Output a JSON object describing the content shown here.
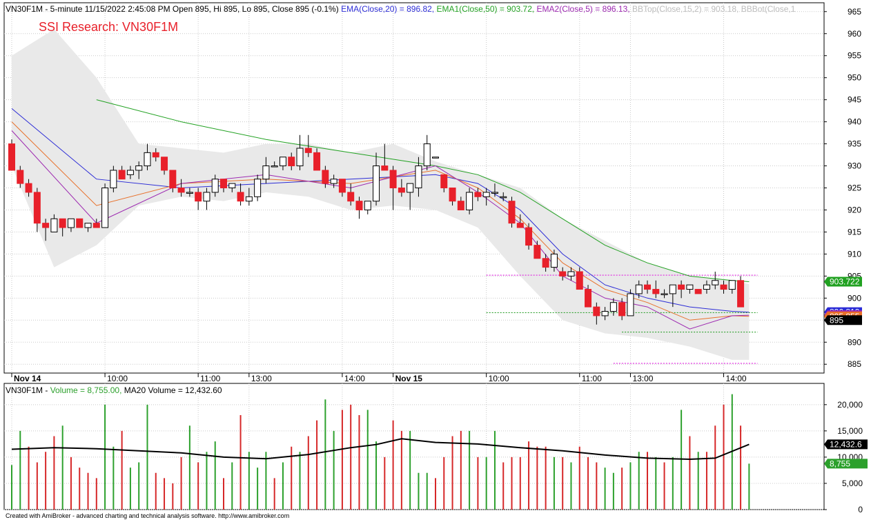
{
  "header": {
    "prefix": "VN30F1M - 5-minute 11/15/2022 2:45:08 PM Open 895, Hi 895, Lo 895, Close 895 (-0.1%) ",
    "ema20": "EMA(Close,20) = 896.82, ",
    "ema50": "EMA1(Close,50) = 903.72, ",
    "ema5": "EMA2(Close,5) = 896.13, ",
    "bbtop": "BBTop(Close,15,2) = 903.18, ",
    "bbbot": "BBBot(Close,1"
  },
  "watermark": "SSI Research: VN30F1M",
  "volume_header": {
    "prefix": "VN30F1M - ",
    "volume": "Volume = 8,755.00, ",
    "ma20": "MA20 Volume = 12,432.60"
  },
  "footer": "Created with AmiBroker - advanced charting and technical analysis software. http://www.amibroker.com",
  "value_tags": [
    {
      "label": "903.722",
      "value": 903.72,
      "bg": "#21a121",
      "fg": "#ffffff"
    },
    {
      "label": "896.819",
      "value": 896.82,
      "bg": "#2b2bd6",
      "fg": "#ffffff"
    },
    {
      "label": "896.128",
      "value": 896.13,
      "bg": "#9c27b0",
      "fg": "#ffffff"
    },
    {
      "label": "895.855",
      "value": 895.86,
      "bg": "#e8702a",
      "fg": "#ffffff"
    },
    {
      "label": "895",
      "value": 895,
      "bg": "#000000",
      "fg": "#ffffff"
    }
  ],
  "volume_tags": [
    {
      "label": "12,432.6",
      "value": 12432.6,
      "bg": "#000000",
      "fg": "#ffffff"
    },
    {
      "label": "8,755",
      "value": 8755,
      "bg": "#2ca02c",
      "fg": "#ffffff"
    }
  ],
  "colors": {
    "up_fill": "#ffffff",
    "down_fill": "#e8202a",
    "candle_outline": "#000000",
    "ema20": "#2b2bd6",
    "ema50": "#21a121",
    "ema5": "#9c27b0",
    "ema_orange": "#e8702a",
    "bb_band": "#e9e9e9",
    "vol_up": "#2ca02c",
    "vol_down": "#d62728",
    "vol_ma": "#000000",
    "level_magenta": "#e020e0",
    "level_green": "#2ca02c",
    "grid": "#c8c8c8"
  },
  "chart_data": [
    {
      "type": "candlestick",
      "title": "VN30F1M - 5-minute",
      "ylim": [
        883,
        967
      ],
      "y_ticks": [
        885,
        890,
        895,
        900,
        905,
        910,
        915,
        920,
        925,
        930,
        935,
        940,
        945,
        950,
        955,
        960,
        965
      ],
      "x_ticks": [
        {
          "i": 0,
          "label": "Nov 14",
          "bold": true
        },
        {
          "i": 11,
          "label": "10:00"
        },
        {
          "i": 22,
          "label": "11:00"
        },
        {
          "i": 28,
          "label": "13:00"
        },
        {
          "i": 39,
          "label": "14:00"
        },
        {
          "i": 45,
          "label": "Nov 15",
          "bold": true
        },
        {
          "i": 56,
          "label": "10:00"
        },
        {
          "i": 67,
          "label": "11:00"
        },
        {
          "i": 73,
          "label": "13:00"
        },
        {
          "i": 84,
          "label": "14:00"
        }
      ],
      "grid": true,
      "candles": [
        [
          935,
          936,
          929,
          929
        ],
        [
          929,
          930,
          925,
          926
        ],
        [
          926,
          927,
          923,
          924
        ],
        [
          924,
          925,
          915,
          917
        ],
        [
          917,
          918,
          913,
          916
        ],
        [
          915,
          919,
          915,
          918
        ],
        [
          918,
          918,
          914,
          916
        ],
        [
          916,
          918,
          915,
          918
        ],
        [
          918,
          918,
          916,
          916
        ],
        [
          916,
          917,
          915,
          917
        ],
        [
          917,
          918,
          916,
          916
        ],
        [
          916,
          926,
          916,
          925
        ],
        [
          925,
          930,
          924,
          929
        ],
        [
          929,
          930,
          927,
          927
        ],
        [
          928,
          930,
          927,
          929
        ],
        [
          929,
          931,
          927,
          930
        ],
        [
          930,
          935,
          929,
          933
        ],
        [
          933,
          934,
          931,
          932
        ],
        [
          932,
          932,
          928,
          929
        ],
        [
          929,
          929,
          924,
          925
        ],
        [
          925,
          927,
          923,
          924
        ],
        [
          924,
          925,
          923,
          924
        ],
        [
          924,
          925,
          920,
          922
        ],
        [
          922,
          925,
          920,
          924
        ],
        [
          924,
          928,
          923,
          927
        ],
        [
          927,
          927,
          924,
          925
        ],
        [
          925,
          926,
          924,
          926
        ],
        [
          924,
          926,
          921,
          922
        ],
        [
          922,
          925,
          921,
          923
        ],
        [
          923,
          928,
          922,
          927
        ],
        [
          927,
          932,
          926,
          930
        ],
        [
          930,
          931,
          930,
          930
        ],
        [
          930,
          932,
          929,
          932
        ],
        [
          932,
          933,
          929,
          930
        ],
        [
          930,
          937,
          929,
          934
        ],
        [
          934,
          937,
          932,
          933
        ],
        [
          933,
          934,
          929,
          929
        ],
        [
          929,
          930,
          925,
          926
        ],
        [
          926,
          928,
          925,
          927
        ],
        [
          927,
          927,
          923,
          924
        ],
        [
          924,
          926,
          921,
          922
        ],
        [
          922,
          923,
          918,
          920
        ],
        [
          920,
          922,
          919,
          922
        ],
        [
          922,
          933,
          921,
          930
        ],
        [
          930,
          935,
          929,
          929
        ],
        [
          929,
          930,
          920,
          925
        ],
        [
          925,
          927,
          923,
          924
        ],
        [
          924,
          925,
          920,
          926
        ],
        [
          925,
          932,
          923,
          930
        ],
        [
          930,
          937,
          929,
          935
        ],
        [
          932,
          932,
          932,
          932
        ],
        [
          928,
          928,
          924,
          925
        ],
        [
          925,
          925,
          921,
          922
        ],
        [
          922,
          923,
          920,
          920
        ],
        [
          920,
          925,
          919,
          924
        ],
        [
          924,
          925,
          922,
          923
        ],
        [
          923,
          925,
          921,
          924
        ],
        [
          924,
          926,
          923,
          924
        ],
        [
          923,
          924,
          922,
          923
        ],
        [
          922,
          923,
          916,
          917
        ],
        [
          917,
          919,
          916,
          916
        ],
        [
          916,
          917,
          911,
          912
        ],
        [
          912,
          913,
          909,
          909
        ],
        [
          909,
          910,
          906,
          907
        ],
        [
          907,
          911,
          906,
          910
        ],
        [
          906,
          907,
          904,
          905
        ],
        [
          905,
          907,
          904,
          906
        ],
        [
          906,
          907,
          902,
          902
        ],
        [
          902,
          903,
          898,
          898
        ],
        [
          898,
          899,
          894,
          896
        ],
        [
          896,
          898,
          895,
          897
        ],
        [
          897,
          900,
          896,
          899
        ],
        [
          899,
          900,
          895,
          896
        ],
        [
          896,
          902,
          896,
          901
        ],
        [
          901,
          904,
          900,
          903
        ],
        [
          903,
          904,
          901,
          902
        ],
        [
          902,
          904,
          900,
          901
        ],
        [
          901,
          902,
          900,
          901
        ],
        [
          901,
          903,
          898,
          903
        ],
        [
          903,
          904,
          900,
          902
        ],
        [
          902,
          903,
          901,
          903
        ],
        [
          902,
          902,
          901,
          901
        ],
        [
          902,
          904,
          901,
          903
        ],
        [
          903,
          906,
          902,
          904
        ],
        [
          903,
          904,
          901,
          902
        ],
        [
          902,
          904,
          901,
          904
        ],
        [
          904,
          905,
          898,
          898
        ]
      ],
      "ema20": [
        [
          0,
          943
        ],
        [
          10,
          927
        ],
        [
          20,
          925
        ],
        [
          30,
          926
        ],
        [
          40,
          927
        ],
        [
          50,
          928
        ],
        [
          55,
          926
        ],
        [
          60,
          920
        ],
        [
          65,
          910
        ],
        [
          70,
          903
        ],
        [
          75,
          900
        ],
        [
          80,
          898
        ],
        [
          85,
          897
        ],
        [
          87,
          896.82
        ]
      ],
      "ema50": [
        [
          10,
          945
        ],
        [
          20,
          940
        ],
        [
          30,
          936
        ],
        [
          40,
          933
        ],
        [
          50,
          930
        ],
        [
          55,
          928
        ],
        [
          60,
          924
        ],
        [
          65,
          918
        ],
        [
          70,
          912
        ],
        [
          75,
          908
        ],
        [
          80,
          905
        ],
        [
          85,
          904
        ],
        [
          87,
          903.72
        ]
      ],
      "ema5": [
        [
          0,
          938
        ],
        [
          10,
          917
        ],
        [
          20,
          926
        ],
        [
          30,
          928
        ],
        [
          40,
          925
        ],
        [
          50,
          930
        ],
        [
          55,
          924
        ],
        [
          60,
          917
        ],
        [
          65,
          905
        ],
        [
          70,
          900
        ],
        [
          75,
          898
        ],
        [
          80,
          893
        ],
        [
          85,
          896
        ],
        [
          87,
          896.13
        ]
      ],
      "ema_orange": [
        [
          0,
          940
        ],
        [
          10,
          921
        ],
        [
          20,
          926
        ],
        [
          30,
          927
        ],
        [
          40,
          926
        ],
        [
          50,
          929
        ],
        [
          55,
          925
        ],
        [
          60,
          918
        ],
        [
          65,
          908
        ],
        [
          70,
          902
        ],
        [
          75,
          899
        ],
        [
          80,
          895
        ],
        [
          85,
          896
        ],
        [
          87,
          895.86
        ]
      ],
      "bb_upper": [
        [
          0,
          955
        ],
        [
          5,
          961
        ],
        [
          10,
          950
        ],
        [
          15,
          935
        ],
        [
          20,
          934
        ],
        [
          25,
          933
        ],
        [
          30,
          935
        ],
        [
          35,
          935
        ],
        [
          40,
          933
        ],
        [
          45,
          935
        ],
        [
          50,
          931
        ],
        [
          55,
          928
        ],
        [
          60,
          925
        ],
        [
          65,
          918
        ],
        [
          70,
          913
        ],
        [
          75,
          908
        ],
        [
          80,
          905
        ],
        [
          85,
          904
        ],
        [
          87,
          903.18
        ]
      ],
      "bb_lower": [
        [
          0,
          930
        ],
        [
          5,
          907
        ],
        [
          10,
          912
        ],
        [
          15,
          921
        ],
        [
          20,
          923
        ],
        [
          25,
          922
        ],
        [
          30,
          924
        ],
        [
          35,
          923
        ],
        [
          40,
          920
        ],
        [
          45,
          921
        ],
        [
          50,
          920
        ],
        [
          55,
          916
        ],
        [
          60,
          905
        ],
        [
          65,
          895
        ],
        [
          70,
          892
        ],
        [
          75,
          891
        ],
        [
          80,
          889
        ],
        [
          85,
          886
        ],
        [
          87,
          886
        ]
      ],
      "levels": [
        {
          "from": 56,
          "to": 88,
          "value": 905.2,
          "color": "#e020e0"
        },
        {
          "from": 56,
          "to": 88,
          "value": 896.7,
          "color": "#2ca02c"
        },
        {
          "from": 72,
          "to": 88,
          "value": 892.3,
          "color": "#2ca02c"
        },
        {
          "from": 71,
          "to": 88,
          "value": 885.2,
          "color": "#e020e0"
        }
      ]
    },
    {
      "type": "bar",
      "title": "Volume",
      "ylim": [
        0,
        23000
      ],
      "y_ticks": [
        0,
        5000,
        10000,
        15000,
        20000
      ],
      "y_tick_labels": [
        "0",
        "5,000",
        "10,000",
        "15,000",
        "20,000"
      ],
      "values": [
        8500,
        15000,
        12000,
        9000,
        11000,
        14000,
        16000,
        10000,
        8000,
        7000,
        6000,
        20000,
        12000,
        15000,
        8000,
        9000,
        20000,
        7000,
        6000,
        5000,
        10000,
        16000,
        9000,
        11000,
        13000,
        6000,
        9000,
        18000,
        11000,
        8000,
        11000,
        6000,
        9000,
        12000,
        11000,
        14000,
        17000,
        21000,
        15000,
        19000,
        20000,
        18000,
        19000,
        13000,
        10000,
        17000,
        15000,
        15000,
        7000,
        7000,
        6000,
        10000,
        14000,
        15000,
        15000,
        10000,
        10000,
        15000,
        9000,
        10000,
        10000,
        13000,
        12000,
        12000,
        10000,
        10000,
        9000,
        12000,
        10000,
        9000,
        8000,
        7000,
        8000,
        9000,
        11000,
        11000,
        10000,
        9000,
        10000,
        19000,
        14000,
        11000,
        11000,
        16000,
        20000,
        22000,
        16000,
        8755
      ],
      "up": [
        true,
        true,
        false,
        false,
        false,
        false,
        true,
        false,
        false,
        false,
        false,
        true,
        true,
        false,
        true,
        true,
        true,
        false,
        false,
        false,
        false,
        true,
        false,
        true,
        true,
        false,
        true,
        false,
        true,
        true,
        true,
        false,
        true,
        false,
        true,
        false,
        false,
        true,
        true,
        false,
        false,
        false,
        true,
        true,
        false,
        false,
        false,
        true,
        true,
        true,
        false,
        false,
        false,
        false,
        true,
        false,
        true,
        true,
        false,
        false,
        false,
        false,
        false,
        false,
        true,
        false,
        true,
        false,
        false,
        false,
        true,
        true,
        false,
        true,
        true,
        false,
        true,
        false,
        true,
        true,
        false,
        true,
        false,
        false,
        false,
        true,
        false,
        true
      ],
      "ma20": [
        [
          0,
          11500
        ],
        [
          5,
          11800
        ],
        [
          10,
          11600
        ],
        [
          15,
          11200
        ],
        [
          20,
          10800
        ],
        [
          25,
          10000
        ],
        [
          30,
          9700
        ],
        [
          35,
          10500
        ],
        [
          40,
          11800
        ],
        [
          43,
          12400
        ],
        [
          46,
          13500
        ],
        [
          50,
          12800
        ],
        [
          55,
          12500
        ],
        [
          60,
          11800
        ],
        [
          65,
          11200
        ],
        [
          70,
          10400
        ],
        [
          75,
          9800
        ],
        [
          80,
          9600
        ],
        [
          83,
          9800
        ],
        [
          87,
          12432.6
        ]
      ]
    }
  ]
}
